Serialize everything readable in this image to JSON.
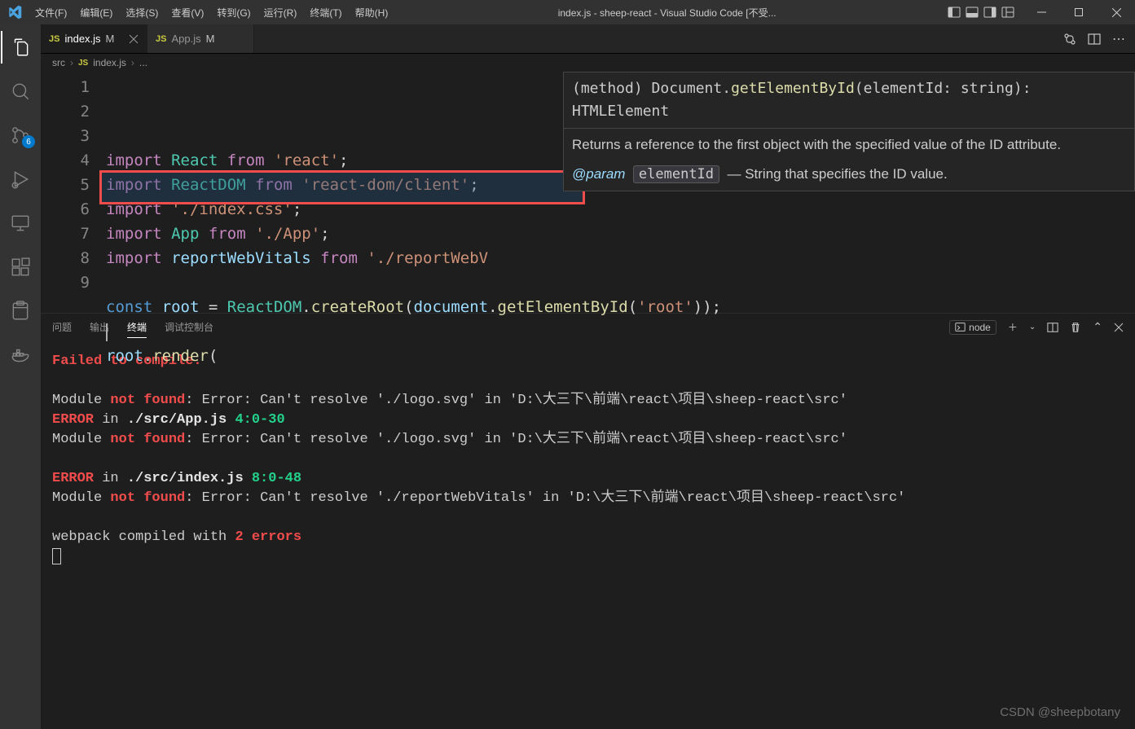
{
  "menubar": [
    "文件(F)",
    "编辑(E)",
    "选择(S)",
    "查看(V)",
    "转到(G)",
    "运行(R)",
    "终端(T)",
    "帮助(H)"
  ],
  "window_title": "index.js - sheep-react - Visual Studio Code [不受...",
  "activity_badge": "6",
  "tabs": [
    {
      "icon": "JS",
      "name": "index.js",
      "modified": "M",
      "active": true,
      "close": true
    },
    {
      "icon": "JS",
      "name": "App.js",
      "modified": "M",
      "active": false,
      "close": false
    }
  ],
  "breadcrumbs": {
    "folder": "src",
    "icon": "JS",
    "file": "index.js",
    "more": "..."
  },
  "gutter": [
    "1",
    "2",
    "3",
    "4",
    "5",
    "6",
    "7",
    "8",
    "9"
  ],
  "code_lines": [
    [
      {
        "c": "kw",
        "t": "import"
      },
      {
        "c": "pc",
        "t": " "
      },
      {
        "c": "ty",
        "t": "React"
      },
      {
        "c": "pc",
        "t": " "
      },
      {
        "c": "kw",
        "t": "from"
      },
      {
        "c": "pc",
        "t": " "
      },
      {
        "c": "st",
        "t": "'react'"
      },
      {
        "c": "pc",
        "t": ";"
      }
    ],
    [
      {
        "c": "kw",
        "t": "import"
      },
      {
        "c": "pc",
        "t": " "
      },
      {
        "c": "ty",
        "t": "ReactDOM"
      },
      {
        "c": "pc",
        "t": " "
      },
      {
        "c": "kw",
        "t": "from"
      },
      {
        "c": "pc",
        "t": " "
      },
      {
        "c": "st",
        "t": "'react-dom/client'"
      },
      {
        "c": "pc",
        "t": ";"
      }
    ],
    [
      {
        "c": "kw",
        "t": "import"
      },
      {
        "c": "pc",
        "t": " "
      },
      {
        "c": "st",
        "t": "'./index.css'"
      },
      {
        "c": "pc",
        "t": ";"
      }
    ],
    [
      {
        "c": "kw",
        "t": "import"
      },
      {
        "c": "pc",
        "t": " "
      },
      {
        "c": "ty",
        "t": "App"
      },
      {
        "c": "pc",
        "t": " "
      },
      {
        "c": "kw",
        "t": "from"
      },
      {
        "c": "pc",
        "t": " "
      },
      {
        "c": "st",
        "t": "'./App'"
      },
      {
        "c": "pc",
        "t": ";"
      }
    ],
    [
      {
        "c": "kw",
        "t": "import"
      },
      {
        "c": "pc",
        "t": " "
      },
      {
        "c": "id",
        "t": "reportWebVitals"
      },
      {
        "c": "pc",
        "t": " "
      },
      {
        "c": "kw",
        "t": "from"
      },
      {
        "c": "pc",
        "t": " "
      },
      {
        "c": "st",
        "t": "'./reportWebV"
      }
    ],
    [],
    [
      {
        "c": "ck",
        "t": "const"
      },
      {
        "c": "pc",
        "t": " "
      },
      {
        "c": "id",
        "t": "root"
      },
      {
        "c": "pc",
        "t": " = "
      },
      {
        "c": "ty",
        "t": "ReactDOM"
      },
      {
        "c": "pc",
        "t": "."
      },
      {
        "c": "fn",
        "t": "createRoot"
      },
      {
        "c": "pc",
        "t": "("
      },
      {
        "c": "id",
        "t": "document"
      },
      {
        "c": "pc",
        "t": "."
      },
      {
        "c": "fn",
        "t": "getElementById"
      },
      {
        "c": "pc",
        "t": "("
      },
      {
        "c": "st",
        "t": "'root'"
      },
      {
        "c": "pc",
        "t": "));"
      }
    ],
    [],
    [
      {
        "c": "id",
        "t": "root"
      },
      {
        "c": "pc",
        "t": "."
      },
      {
        "c": "fn",
        "t": "render"
      },
      {
        "c": "pc",
        "t": "("
      }
    ]
  ],
  "highlight": {
    "line": 5
  },
  "hover": {
    "sig_pre": "(method) Document.",
    "sig_fn": "getElementById",
    "sig_post": "(elementId: string): HTMLElement",
    "desc": "Returns a reference to the first object with the specified value of the ID attribute.",
    "param_tag": "@param",
    "param_name": "elementId",
    "param_desc": "— String that specifies the ID value."
  },
  "panel": {
    "tabs": [
      "问题",
      "输出",
      "终端",
      "调试控制台"
    ],
    "active": 2,
    "shell": "node"
  },
  "terminal_lines": [
    [
      {
        "c": "t-red",
        "t": "Failed to compile."
      }
    ],
    [],
    [
      {
        "c": "",
        "t": "Module "
      },
      {
        "c": "t-red-b",
        "t": "not found"
      },
      {
        "c": "",
        "t": ": Error: Can't resolve './logo.svg' in 'D:\\大三下\\前端\\react\\项目\\sheep-react\\src'"
      }
    ],
    [
      {
        "c": "t-red-b",
        "t": "ERROR"
      },
      {
        "c": "",
        "t": " in "
      },
      {
        "c": "t-wht",
        "t": "./src/App.js"
      },
      {
        "c": "",
        "t": " "
      },
      {
        "c": "t-grn",
        "t": "4:0-30"
      }
    ],
    [
      {
        "c": "",
        "t": "Module "
      },
      {
        "c": "t-red-b",
        "t": "not found"
      },
      {
        "c": "",
        "t": ": Error: Can't resolve './logo.svg' in 'D:\\大三下\\前端\\react\\项目\\sheep-react\\src'"
      }
    ],
    [],
    [
      {
        "c": "t-red-b",
        "t": "ERROR"
      },
      {
        "c": "",
        "t": " in "
      },
      {
        "c": "t-wht",
        "t": "./src/index.js"
      },
      {
        "c": "",
        "t": " "
      },
      {
        "c": "t-grn",
        "t": "8:0-48"
      }
    ],
    [
      {
        "c": "",
        "t": "Module "
      },
      {
        "c": "t-red-b",
        "t": "not found"
      },
      {
        "c": "",
        "t": ": Error: Can't resolve './reportWebVitals' in 'D:\\大三下\\前端\\react\\项目\\sheep-react\\src'"
      }
    ],
    [],
    [
      {
        "c": "",
        "t": "webpack compiled with "
      },
      {
        "c": "t-red-b",
        "t": "2 errors"
      }
    ]
  ],
  "watermark": "CSDN @sheepbotany"
}
